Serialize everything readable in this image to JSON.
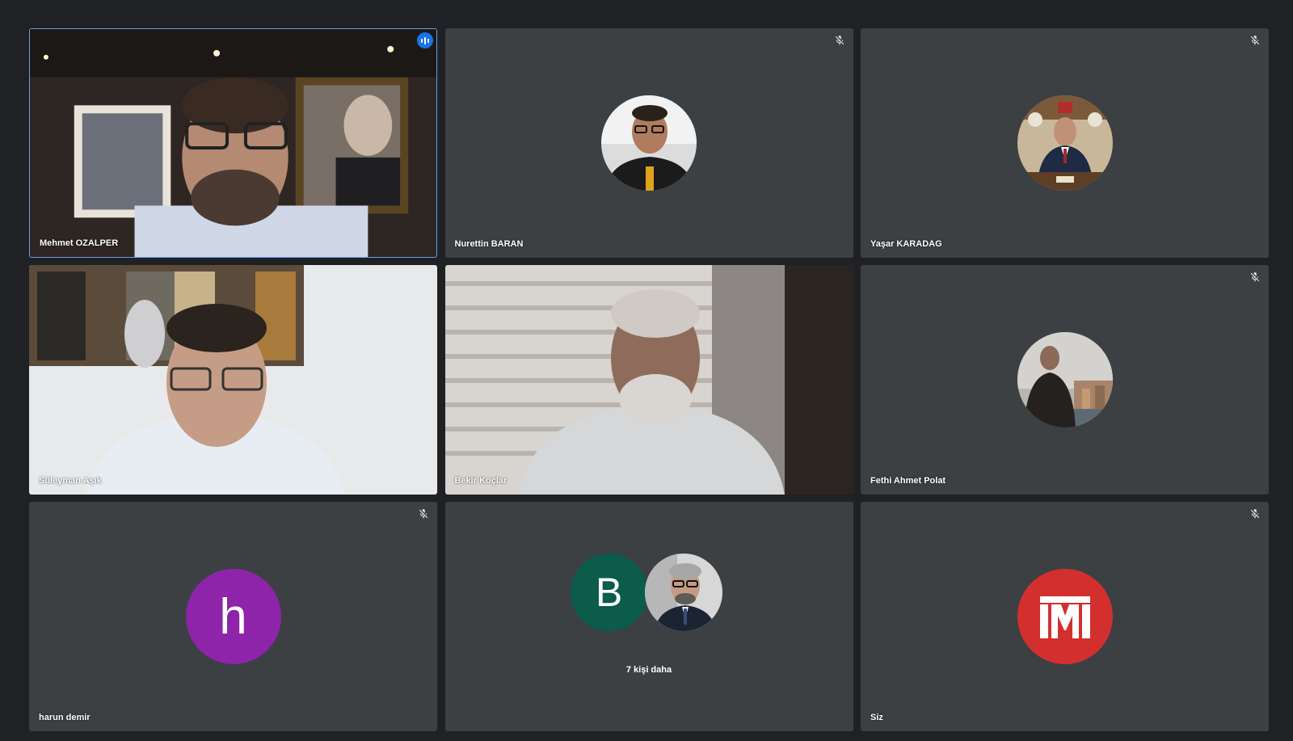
{
  "meeting": {
    "tiles": [
      {
        "name": "Mehmet OZALPER",
        "type": "video",
        "speaking": true
      },
      {
        "name": "Nurettin BARAN",
        "type": "photo-avatar",
        "muted": true
      },
      {
        "name": "Yaşar KARADAG",
        "type": "photo-avatar",
        "muted": true
      },
      {
        "name": "Süleyman Aşık",
        "type": "video"
      },
      {
        "name": "Bekir Koçlar",
        "type": "video"
      },
      {
        "name": "Fethi Ahmet Polat",
        "type": "photo-avatar",
        "muted": true
      },
      {
        "name": "harun demir",
        "type": "letter-avatar",
        "letter": "h",
        "color": "#8e24aa",
        "muted": true
      },
      {
        "name": "",
        "type": "overflow",
        "letter": "B",
        "color": "#0b5c4a",
        "more_label": "7 kişi daha"
      },
      {
        "name": "Siz",
        "type": "logo-avatar",
        "color": "#d32f2f",
        "muted": true
      }
    ]
  },
  "icons": {
    "muted": "mic-off-icon",
    "speaking": "audio-level-icon"
  },
  "colors": {
    "background": "#202124",
    "tile": "#3c4043",
    "active_speaker_border": "#8ab4f8"
  }
}
